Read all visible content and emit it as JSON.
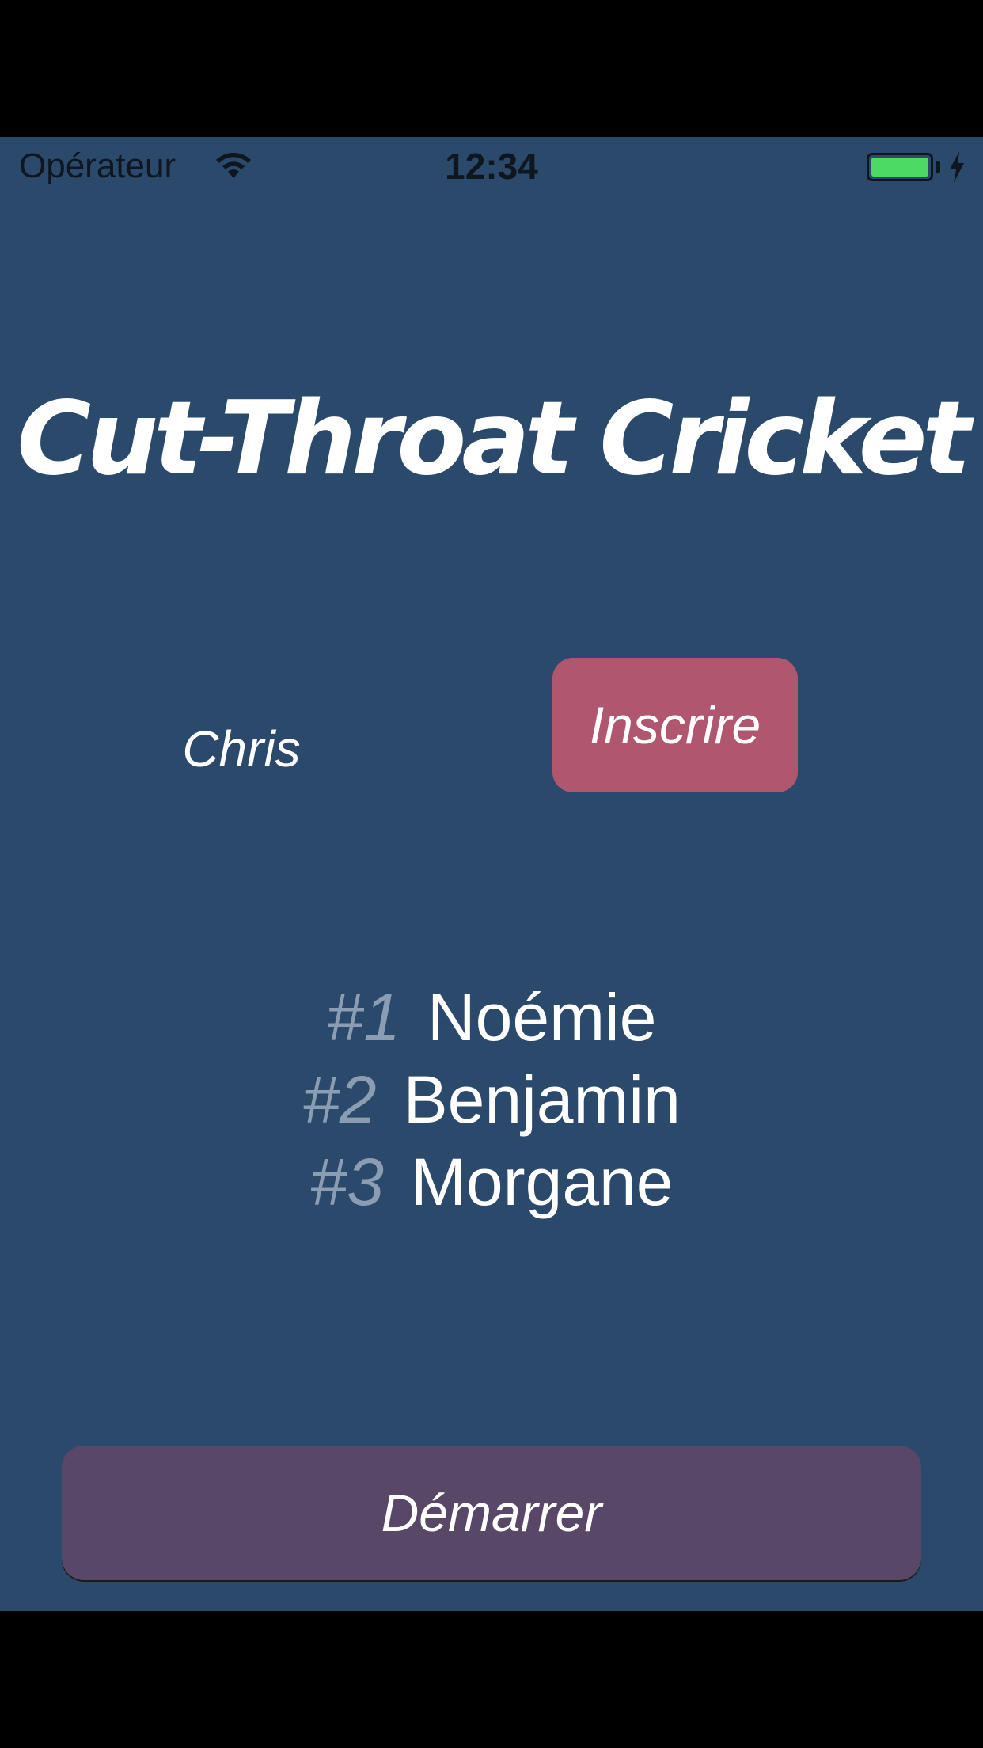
{
  "status_bar": {
    "carrier": "Opérateur",
    "time": "12:34",
    "battery_level": 1.0,
    "battery_color": "#4cd964",
    "wifi_icon": "wifi-icon",
    "charging_icon": "bolt-icon"
  },
  "app": {
    "title": "Cut-Throat Cricket",
    "background_color": "#2b4a6b"
  },
  "registration": {
    "name_value": "Chris",
    "register_label": "Inscrire",
    "register_color": "#b1566f"
  },
  "players": [
    {
      "rank": "#1",
      "name": "Noémie"
    },
    {
      "rank": "#2",
      "name": "Benjamin"
    },
    {
      "rank": "#3",
      "name": "Morgane"
    }
  ],
  "start": {
    "label": "Démarrer",
    "color": "#584767"
  }
}
